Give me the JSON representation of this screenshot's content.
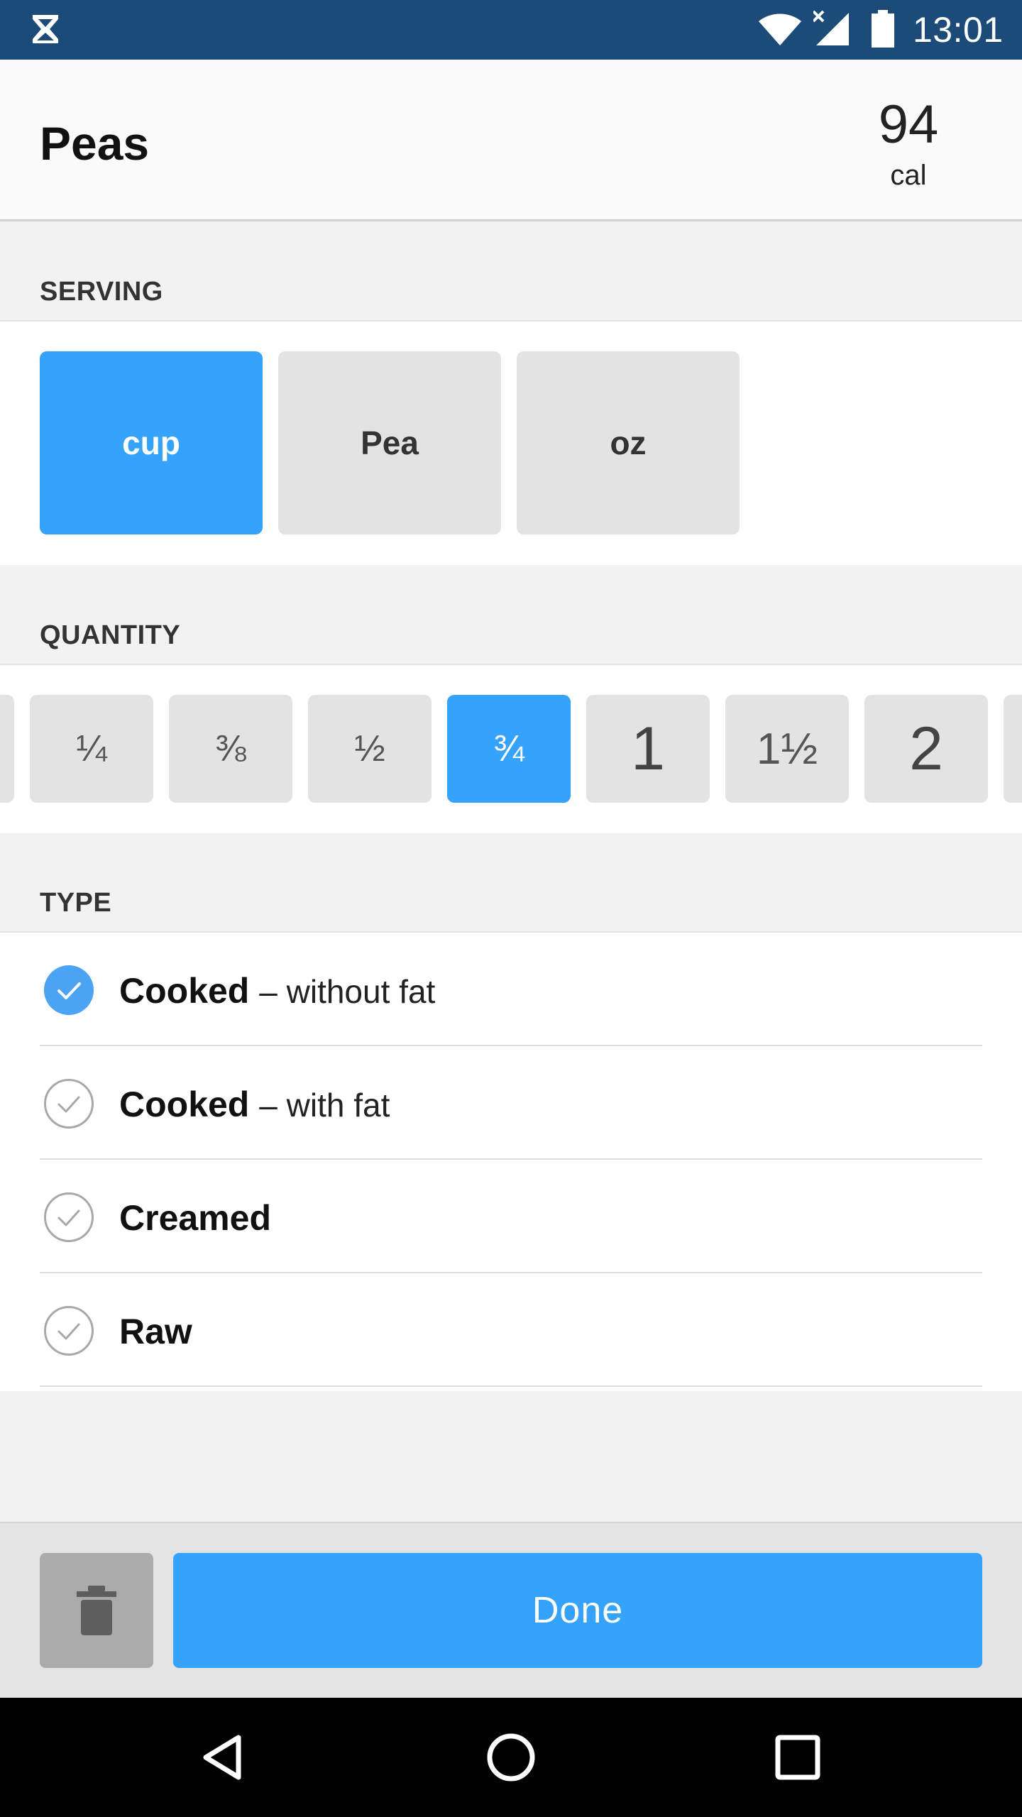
{
  "status_bar": {
    "time": "13:01",
    "icons": [
      "hourglass-icon",
      "wifi-icon",
      "cell-signal-icon",
      "battery-icon"
    ]
  },
  "header": {
    "title": "Peas",
    "calories": "94",
    "calories_unit": "cal"
  },
  "serving": {
    "label": "SERVING",
    "options": [
      {
        "label": "cup",
        "selected": true
      },
      {
        "label": "Pea",
        "selected": false
      },
      {
        "label": "oz",
        "selected": false
      }
    ]
  },
  "quantity": {
    "label": "QUANTITY",
    "options": [
      {
        "label": "¼",
        "selected": false
      },
      {
        "label": "⅜",
        "selected": false
      },
      {
        "label": "½",
        "selected": false
      },
      {
        "label": "¾",
        "selected": true
      },
      {
        "label": "1",
        "selected": false
      },
      {
        "label": "1½",
        "selected": false
      },
      {
        "label": "2",
        "selected": false
      }
    ]
  },
  "type": {
    "label": "TYPE",
    "options": [
      {
        "name": "Cooked",
        "detail": "– without fat",
        "selected": true
      },
      {
        "name": "Cooked",
        "detail": "– with fat",
        "selected": false
      },
      {
        "name": "Creamed",
        "detail": "",
        "selected": false
      },
      {
        "name": "Raw",
        "detail": "",
        "selected": false
      }
    ]
  },
  "actions": {
    "delete_icon": "trash-icon",
    "done_label": "Done"
  },
  "nav": {
    "icons": [
      "back-icon",
      "home-icon",
      "recents-icon"
    ]
  },
  "colors": {
    "accent": "#35a2fb",
    "status_bar": "#1c4b7a",
    "button_grey": "#e3e3e3"
  }
}
